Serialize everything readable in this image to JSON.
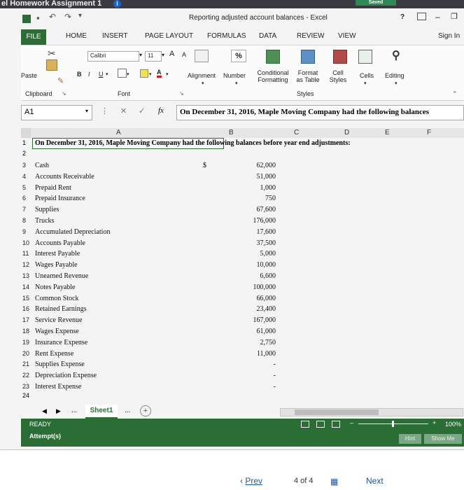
{
  "browser": {
    "tab_title": "el Homework Assignment 1",
    "info_badge": "i",
    "saved_label": "Saved"
  },
  "window": {
    "title": "Reporting adjusted account balances - Excel",
    "help": "?",
    "sign_in": "Sign In"
  },
  "tabs": [
    "FILE",
    "HOME",
    "INSERT",
    "PAGE LAYOUT",
    "FORMULAS",
    "DATA",
    "REVIEW",
    "VIEW"
  ],
  "ribbon": {
    "paste": "Paste",
    "font_name": "Calibri",
    "font_size": "11",
    "bold": "B",
    "italic": "I",
    "underline": "U",
    "grow_font": "A",
    "shrink_font": "A",
    "alignment": "Alignment",
    "number": "Number",
    "number_symbol": "%",
    "conditional_formatting": "Conditional Formatting",
    "format_as_table": "Format as Table",
    "cell_styles": "Cell Styles",
    "cells": "Cells",
    "editing": "Editing",
    "groups": {
      "clipboard": "Clipboard",
      "font": "Font",
      "styles": "Styles"
    }
  },
  "formula_bar": {
    "name_box": "A1",
    "fx": "fx",
    "content": "On December 31, 2016, Maple Moving Company had the following balances"
  },
  "columns": [
    "A",
    "B",
    "C",
    "D",
    "E",
    "F"
  ],
  "sheet": {
    "heading_row": "1",
    "heading": "On December 31, 2016, Maple Moving Company had the following balances before year end adjustments:",
    "empty_rows": [
      "2",
      "24"
    ],
    "currency": "$",
    "rows": [
      {
        "num": "3",
        "label": "Cash",
        "value": "62,000"
      },
      {
        "num": "4",
        "label": "Accounts Receivable",
        "value": "51,000"
      },
      {
        "num": "5",
        "label": "Prepaid Rent",
        "value": "1,000"
      },
      {
        "num": "6",
        "label": "Prepaid Insurance",
        "value": "750"
      },
      {
        "num": "7",
        "label": "Supplies",
        "value": "67,600"
      },
      {
        "num": "8",
        "label": "Trucks",
        "value": "176,000"
      },
      {
        "num": "9",
        "label": "Accumulated Depreciation",
        "value": "17,600"
      },
      {
        "num": "10",
        "label": "Accounts Payable",
        "value": "37,500"
      },
      {
        "num": "11",
        "label": "Interest Payable",
        "value": "5,000"
      },
      {
        "num": "12",
        "label": "Wages Payable",
        "value": "10,000"
      },
      {
        "num": "13",
        "label": "Unearned Revenue",
        "value": "6,600"
      },
      {
        "num": "14",
        "label": "Notes Payable",
        "value": "100,000"
      },
      {
        "num": "15",
        "label": "Common Stock",
        "value": "66,000"
      },
      {
        "num": "16",
        "label": "Retained Earnings",
        "value": "23,400"
      },
      {
        "num": "17",
        "label": "Service Revenue",
        "value": "167,000"
      },
      {
        "num": "18",
        "label": "Wages Expense",
        "value": "61,000"
      },
      {
        "num": "19",
        "label": "Insurance Expense",
        "value": "2,750"
      },
      {
        "num": "20",
        "label": "Rent Expense",
        "value": "11,000"
      },
      {
        "num": "21",
        "label": "Supplies Expense",
        "value": "-"
      },
      {
        "num": "22",
        "label": "Depreciation Expense",
        "value": "-"
      },
      {
        "num": "23",
        "label": "Interest Expense",
        "value": "-"
      }
    ]
  },
  "sheet_tabs": {
    "ellipsis": "...",
    "active": "Sheet1",
    "ellipsis_right": "...",
    "add": "+"
  },
  "status": {
    "ready": "READY",
    "attempts": "Attempt(s)",
    "zoom": "100%",
    "hint": "Hint",
    "show_me": "Show Me"
  },
  "pager": {
    "prev": "Prev",
    "position": "4 of 4",
    "next": "Next"
  },
  "colors": {
    "excel_green": "#2a6e36",
    "dark_bar": "#3a3a40",
    "link_blue": "#1a56a8"
  }
}
